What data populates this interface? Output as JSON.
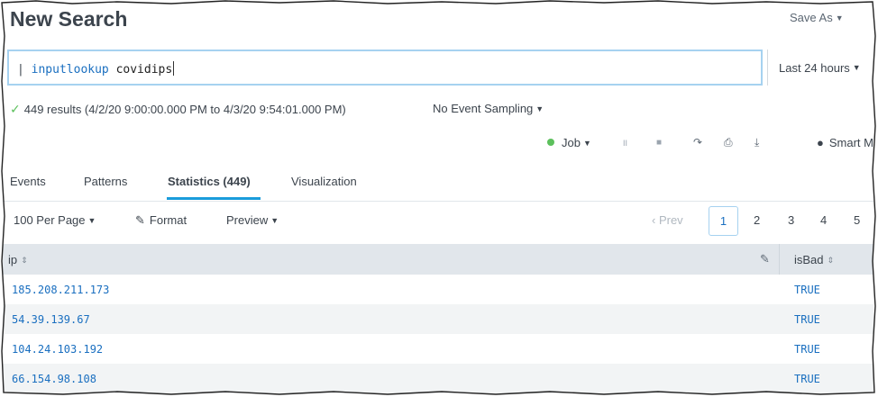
{
  "header": {
    "title": "New Search",
    "save_as": "Save As"
  },
  "search": {
    "pipe": "| ",
    "command": "inputlookup",
    "argument": " covidips",
    "time_range": "Last 24 hours"
  },
  "status": {
    "results_text": "449 results (4/2/20 9:00:00.000 PM to 4/3/20 9:54:01.000 PM)",
    "sampling": "No Event Sampling"
  },
  "jobbar": {
    "job": "Job",
    "pause_icon": "II",
    "stop_icon": "■",
    "share_icon": "↷",
    "print_icon": "⎙",
    "export_icon": "⤓",
    "smart_mode": "Smart M"
  },
  "tabs": [
    {
      "label": "Events"
    },
    {
      "label": "Patterns"
    },
    {
      "label": "Statistics (449)",
      "active": true
    },
    {
      "label": "Visualization"
    }
  ],
  "controls": {
    "per_page": "100 Per Page",
    "format": "Format",
    "preview": "Preview",
    "prev": "‹ Prev",
    "pages": [
      "1",
      "2",
      "3",
      "4",
      "5"
    ]
  },
  "table": {
    "columns": [
      "ip",
      "isBad"
    ],
    "rows": [
      {
        "ip": "185.208.211.173",
        "isBad": "TRUE"
      },
      {
        "ip": "54.39.139.67",
        "isBad": "TRUE"
      },
      {
        "ip": "104.24.103.192",
        "isBad": "TRUE"
      },
      {
        "ip": "66.154.98.108",
        "isBad": "TRUE"
      }
    ]
  },
  "colors": {
    "accent": "#1a9cdb",
    "link": "#1a6fc0",
    "success": "#5cc05c",
    "header_bg": "#e1e6eb"
  }
}
